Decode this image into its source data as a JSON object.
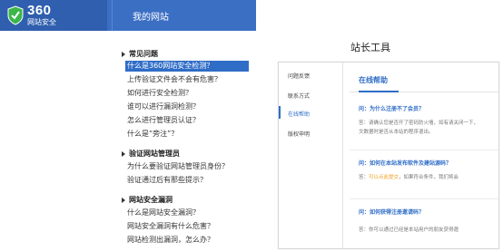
{
  "left_panel": {
    "logo": {
      "brand": "360",
      "subtitle": "网站安全"
    },
    "nav_title": "我的网站",
    "sections": [
      {
        "title": "常见问题",
        "items": [
          {
            "label": "什么是360网站安全检测？",
            "active": true
          },
          {
            "label": "上传验证文件会不会有危害？"
          },
          {
            "label": "如何进行安全检测？"
          },
          {
            "label": "谁可以进行漏洞检测？"
          },
          {
            "label": "怎么进行管理员认证？"
          },
          {
            "label": "什么是“旁注”？"
          }
        ]
      },
      {
        "title": "验证网站管理员",
        "items": [
          {
            "label": "为什么要验证网站管理员身份？"
          },
          {
            "label": "验证通过后有那些提示？"
          }
        ]
      },
      {
        "title": "网站安全漏洞",
        "items": [
          {
            "label": "什么是网站安全漏洞？"
          },
          {
            "label": "网站安全漏洞有什么危害？"
          },
          {
            "label": "网站检测出漏洞，怎么办？"
          }
        ]
      }
    ]
  },
  "right_panel": {
    "caption": "站长工具",
    "sidebar": [
      {
        "label": "问题反馈"
      },
      {
        "label": "联系方式"
      },
      {
        "label": "在线帮助",
        "active": true
      },
      {
        "label": "版权申明"
      }
    ],
    "title": "在线帮助",
    "qa": [
      {
        "q": "问：为什么注册不了会员？",
        "a": "答：请确认您是否开了密码防火墙，如有请关闭一下，",
        "a2": "文数据时是否从本站的程序退出。"
      },
      {
        "q": "问：如何在本站发布软件及建站源码？",
        "a_pre": "答：",
        "a_hl": "可以点此提交",
        "a_post": "，如果符合条件，我们将会"
      },
      {
        "q": "问：如何获得注册邀请码？",
        "a": "答：你可以通过已经是本站用户的朋友获得邀"
      }
    ]
  },
  "colors": {
    "primary_blue": "#3b6fc4",
    "active_blue": "#2f6dc7",
    "highlight_orange": "#f0a020"
  }
}
